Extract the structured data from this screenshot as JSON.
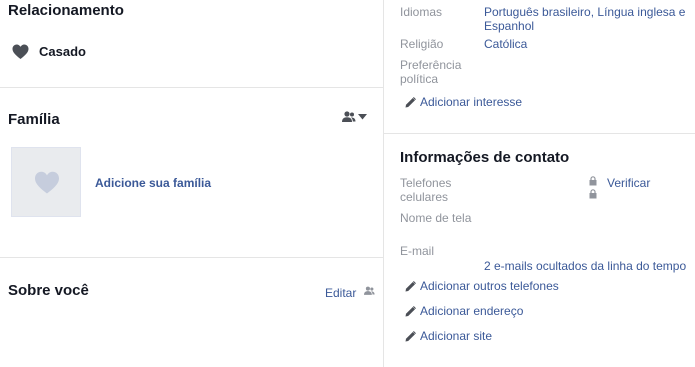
{
  "left": {
    "relationship": {
      "title": "Relacionamento",
      "status": "Casado"
    },
    "family": {
      "title": "Família",
      "add_label": "Adicione sua família"
    },
    "about": {
      "title": "Sobre você",
      "edit_label": "Editar"
    }
  },
  "right": {
    "basic": {
      "languages_label": "Idiomas",
      "languages_value": "Português brasileiro, Língua inglesa e Espanhol",
      "religion_label": "Religião",
      "religion_value": "Católica",
      "preference_label": "Preferência política",
      "add_interest": "Adicionar interesse"
    },
    "contact": {
      "title": "Informações de contato",
      "phones_label": "Telefones celulares",
      "verify_label": "Verificar",
      "screen_name_label": "Nome de tela",
      "email_label": "E-mail",
      "email_hidden": "2 e-mails ocultados da linha do tempo",
      "add_phones": "Adicionar outros telefones",
      "add_address": "Adicionar endereço",
      "add_site": "Adicionar site"
    }
  },
  "colors": {
    "link": "#3b5998",
    "muted": "#90949c",
    "divider": "#e5e5e5",
    "heart": "#4b4f56",
    "placeholder_bg": "#e9ebee",
    "placeholder_heart": "#c6cddd"
  },
  "icons": [
    "heart-icon",
    "friends-icon",
    "caret-down-icon",
    "pencil-icon",
    "lock-icon"
  ]
}
